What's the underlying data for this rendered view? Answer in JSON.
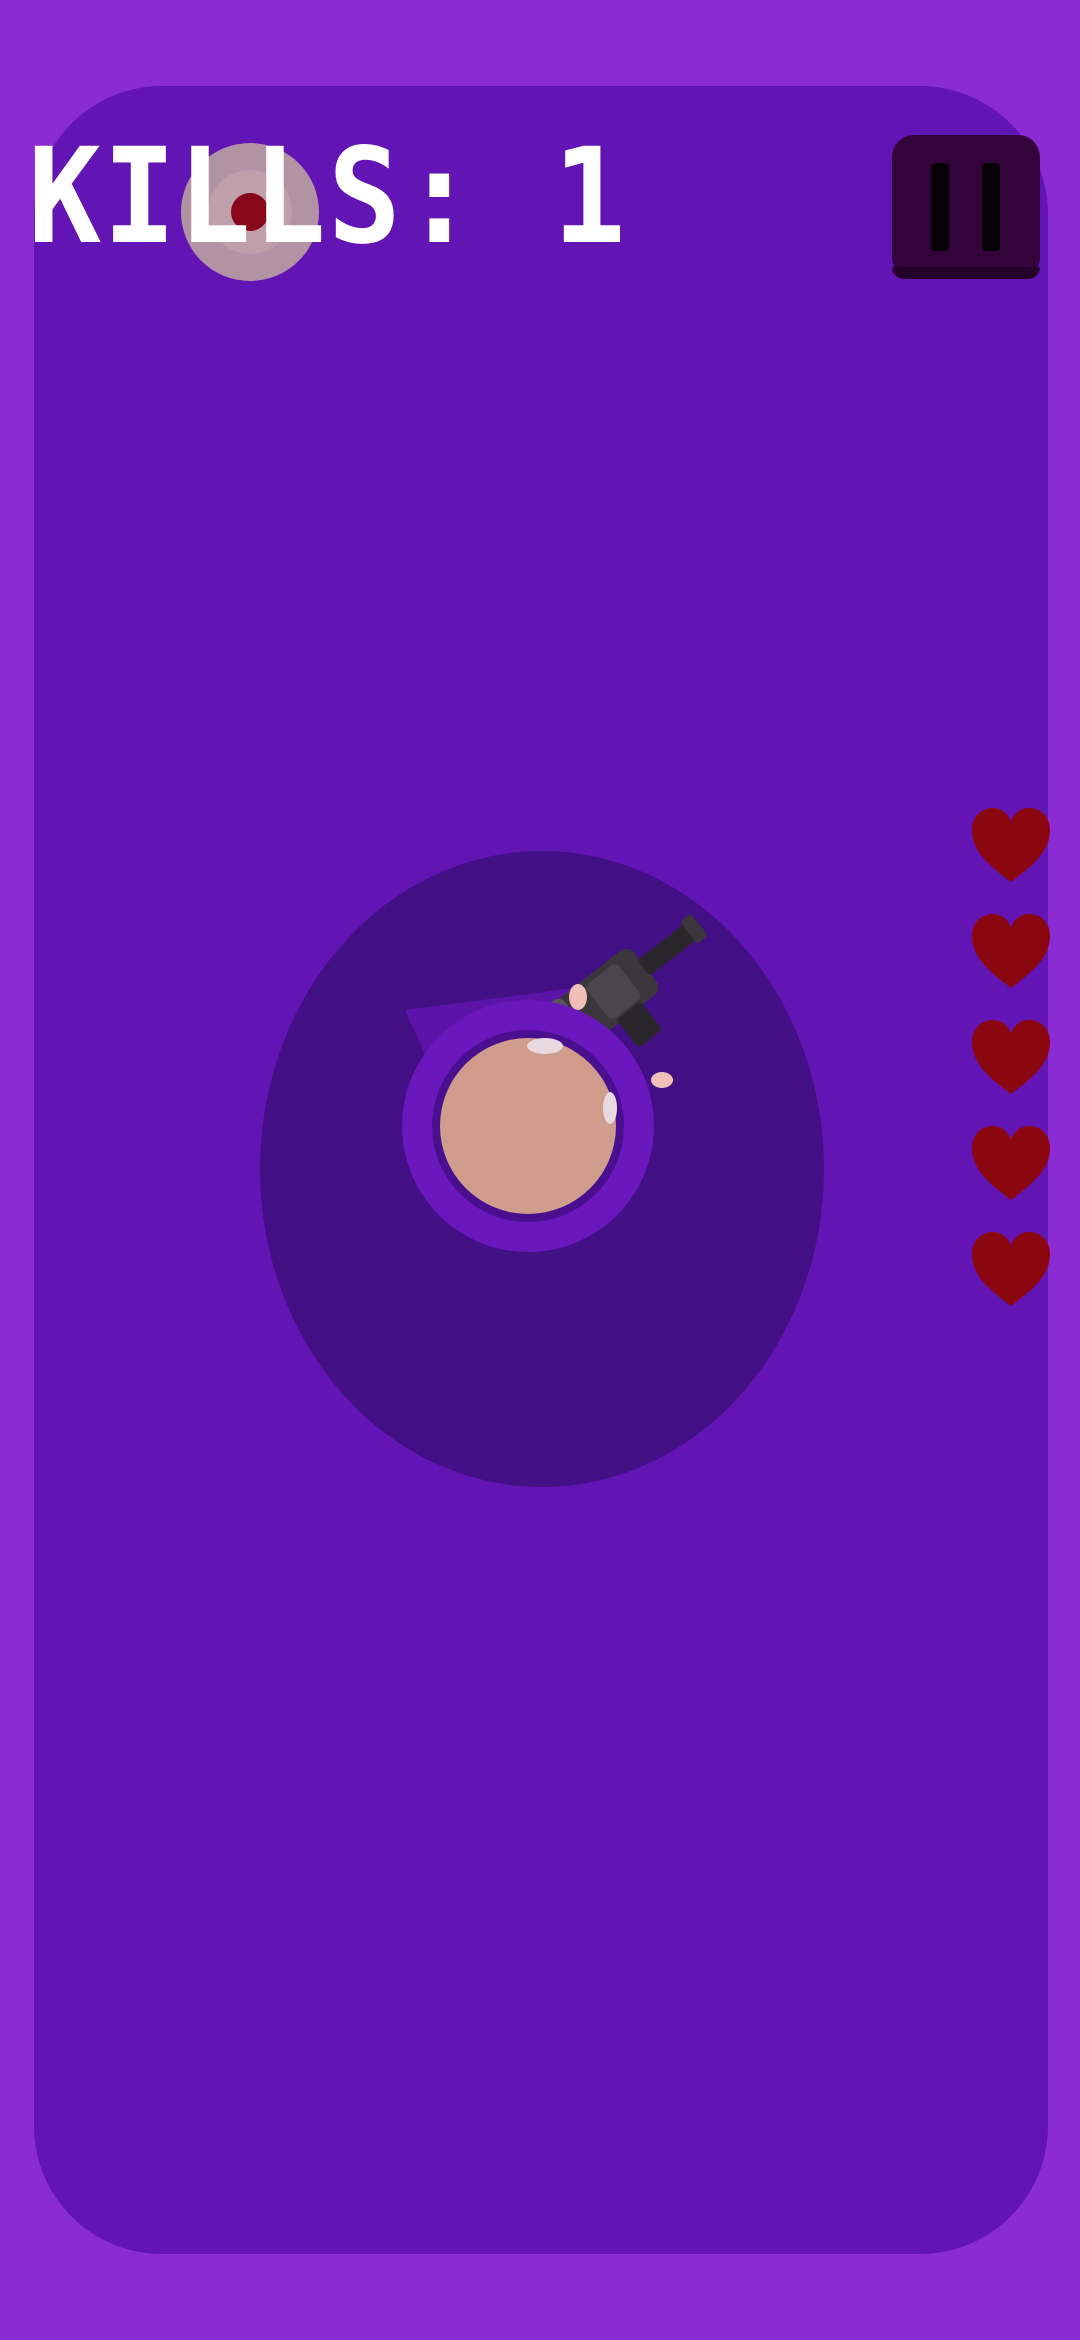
{
  "hud": {
    "kills_label": "KILLS: 1",
    "pause_icon": "pause-icon"
  },
  "lives": {
    "count": 5,
    "icon": "heart-icon",
    "color": "#8b0710"
  },
  "colors": {
    "background": "#8a2bd3",
    "arena": "#6214b4",
    "shadow_zone": "#430f84",
    "player_skin": "#d09c8c",
    "enemy": "#b69aa3"
  }
}
